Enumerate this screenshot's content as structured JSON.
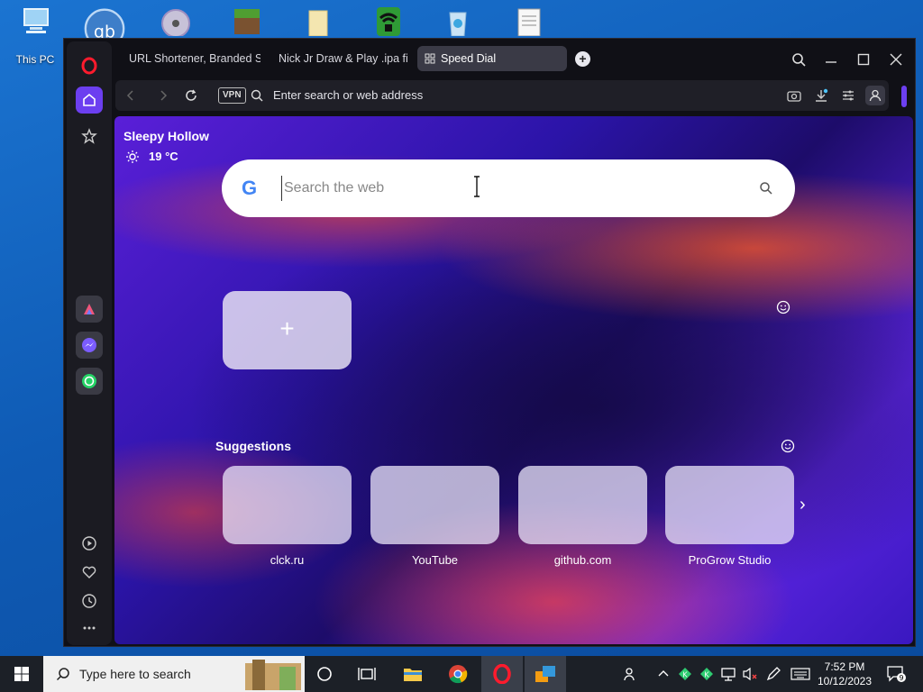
{
  "desktop": {
    "this_pc_label": "This PC",
    "qb_label": "qb"
  },
  "browser": {
    "tabs": [
      {
        "label": "URL Shortener, Branded S",
        "active": false
      },
      {
        "label": "Nick Jr Draw & Play .ipa fi",
        "active": false
      },
      {
        "label": "Speed Dial",
        "active": true
      }
    ],
    "add_tab": "+",
    "vpn_label": "VPN",
    "address_placeholder": "Enter search or web address",
    "accent": "#6c3ff0"
  },
  "speed_dial": {
    "weather": {
      "city": "Sleepy Hollow",
      "temp": "19 °C"
    },
    "search": {
      "placeholder": "Search the web",
      "engine_logo": "G"
    },
    "add_tile": "+",
    "suggestions_title": "Suggestions",
    "suggestions": [
      {
        "label": "clck.ru"
      },
      {
        "label": "YouTube"
      },
      {
        "label": "github.com"
      },
      {
        "label": "ProGrow Studio"
      }
    ],
    "next": "›"
  },
  "taskbar": {
    "search_placeholder": "Type here to search",
    "time": "7:52 PM",
    "date": "10/12/2023",
    "notifications": "9"
  }
}
